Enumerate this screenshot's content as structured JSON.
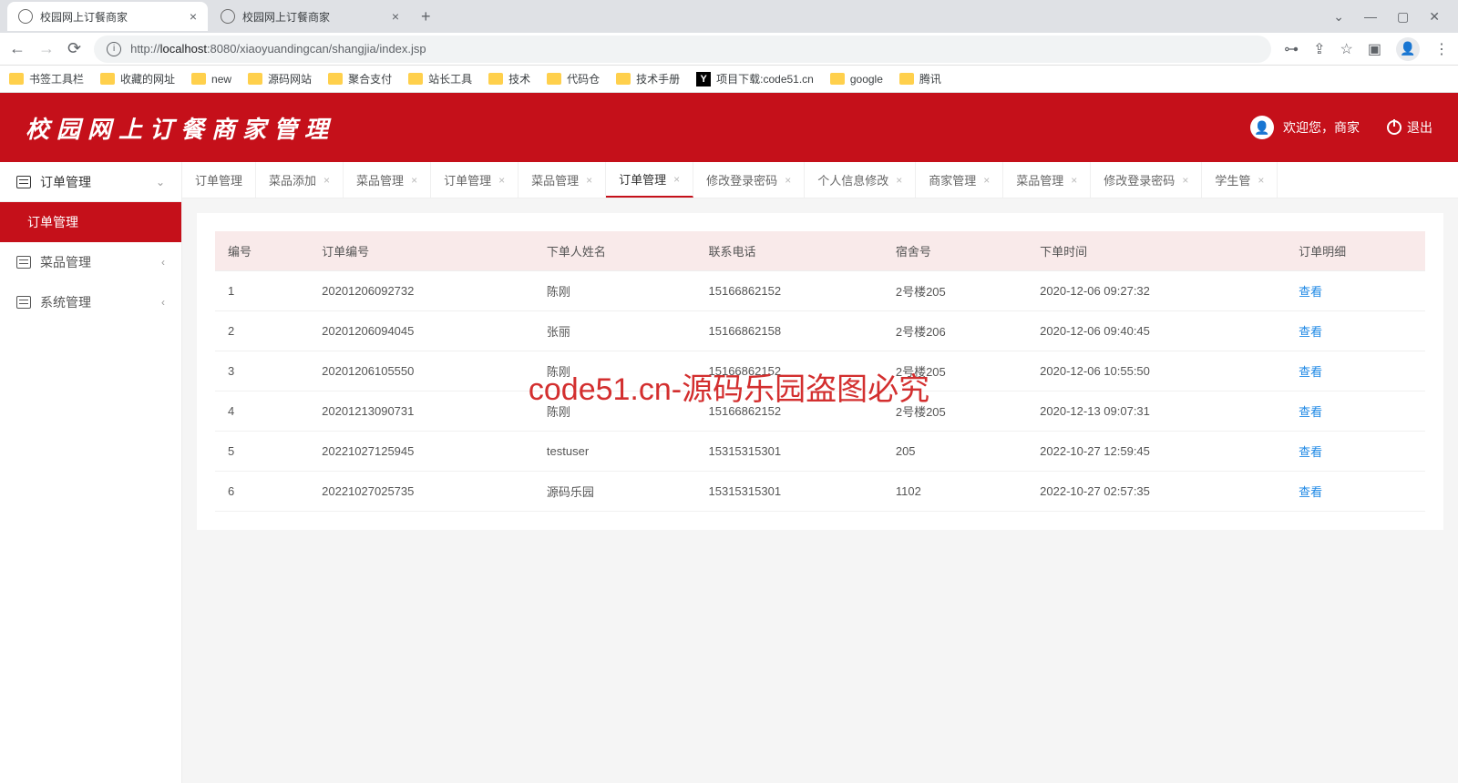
{
  "browser": {
    "tabs": [
      {
        "title": "校园网上订餐商家",
        "active": true
      },
      {
        "title": "校园网上订餐商家",
        "active": false
      }
    ],
    "url_prefix": "http://",
    "url_host": "localhost",
    "url_port": ":8080",
    "url_path": "/xiaoyuandingcan/shangjia/index.jsp",
    "bookmarks": [
      "书签工具栏",
      "收藏的网址",
      "new",
      "源码网站",
      "聚合支付",
      "站长工具",
      "技术",
      "代码仓",
      "技术手册",
      "项目下载:code51.cn",
      "google",
      "腾讯"
    ]
  },
  "app": {
    "title": "校园网上订餐商家管理",
    "welcome": "欢迎您，商家",
    "logout": "退出"
  },
  "sidebar": {
    "top": "订单管理",
    "active": "订单管理",
    "items": [
      "菜品管理",
      "系统管理"
    ]
  },
  "contentTabs": [
    "订单管理",
    "菜品添加",
    "菜品管理",
    "订单管理",
    "菜品管理",
    "订单管理",
    "修改登录密码",
    "个人信息修改",
    "商家管理",
    "菜品管理",
    "修改登录密码",
    "学生管"
  ],
  "activeTabIndex": 5,
  "table": {
    "headers": [
      "编号",
      "订单编号",
      "下单人姓名",
      "联系电话",
      "宿舍号",
      "下单时间",
      "订单明细"
    ],
    "viewLabel": "查看",
    "rows": [
      {
        "id": "1",
        "order": "20201206092732",
        "name": "陈刚",
        "phone": "15166862152",
        "dorm": "2号楼205",
        "time": "2020-12-06 09:27:32"
      },
      {
        "id": "2",
        "order": "20201206094045",
        "name": "张丽",
        "phone": "15166862158",
        "dorm": "2号楼206",
        "time": "2020-12-06 09:40:45"
      },
      {
        "id": "3",
        "order": "20201206105550",
        "name": "陈刚",
        "phone": "15166862152",
        "dorm": "2号楼205",
        "time": "2020-12-06 10:55:50"
      },
      {
        "id": "4",
        "order": "20201213090731",
        "name": "陈刚",
        "phone": "15166862152",
        "dorm": "2号楼205",
        "time": "2020-12-13 09:07:31"
      },
      {
        "id": "5",
        "order": "20221027125945",
        "name": "testuser",
        "phone": "15315315301",
        "dorm": "205",
        "time": "2022-10-27 12:59:45"
      },
      {
        "id": "6",
        "order": "20221027025735",
        "name": "源码乐园",
        "phone": "15315315301",
        "dorm": "1102",
        "time": "2022-10-27 02:57:35"
      }
    ]
  },
  "watermark": "code51.cn-源码乐园盗图必究"
}
